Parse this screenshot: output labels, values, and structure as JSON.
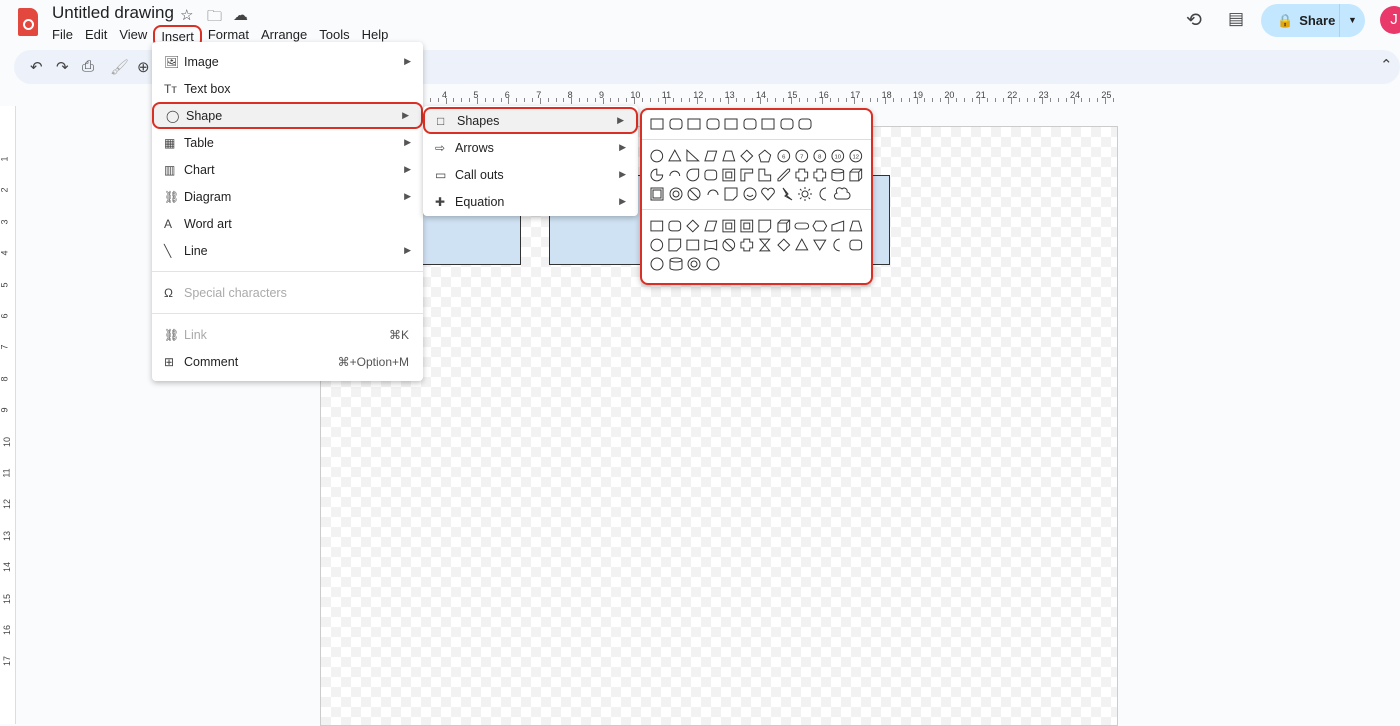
{
  "app": {
    "title": "Untitled drawing",
    "icons": [
      "star-icon",
      "move-to-folder-icon",
      "cloud-saved-icon"
    ]
  },
  "menubar": [
    "File",
    "Edit",
    "View",
    "Insert",
    "Format",
    "Arrange",
    "Tools",
    "Help"
  ],
  "toolbar": {
    "icons": [
      "undo-icon",
      "redo-icon",
      "print-icon",
      "paint-format-icon",
      "zoom-icon"
    ]
  },
  "header": {
    "share_label": "Share",
    "avatar_letter": "J"
  },
  "ruler": {
    "top": [
      4,
      5,
      6,
      7,
      8,
      9,
      10,
      11,
      12,
      13,
      14,
      15,
      16,
      17,
      18,
      19,
      20,
      21,
      22,
      23,
      24,
      25
    ],
    "left": [
      1,
      2,
      3,
      4,
      5,
      6,
      7,
      8,
      9,
      10,
      11,
      12,
      13,
      14,
      15,
      16,
      17
    ]
  },
  "insert_menu": {
    "items": [
      {
        "label": "Image",
        "icon": "image-icon",
        "sub": true
      },
      {
        "label": "Text box",
        "icon": "text-box-icon"
      },
      {
        "label": "Shape",
        "icon": "shape-icon",
        "sub": true,
        "selected": true
      },
      {
        "label": "Table",
        "icon": "table-icon",
        "sub": true
      },
      {
        "label": "Chart",
        "icon": "chart-icon",
        "sub": true
      },
      {
        "label": "Diagram",
        "icon": "diagram-icon",
        "sub": true
      },
      {
        "label": "Word art",
        "icon": "word-art-icon"
      },
      {
        "label": "Line",
        "icon": "line-icon",
        "sub": true
      },
      {
        "sep": true
      },
      {
        "label": "Special characters",
        "icon": "omega-icon",
        "disabled": true
      },
      {
        "sep": true
      },
      {
        "label": "Link",
        "icon": "link-icon",
        "disabled": true,
        "shortcut": "⌘K"
      },
      {
        "label": "Comment",
        "icon": "comment-icon",
        "shortcut": "⌘+Option+M"
      }
    ]
  },
  "shape_menu": {
    "items": [
      {
        "label": "Shapes",
        "icon": "square-icon",
        "selected": true
      },
      {
        "label": "Arrows",
        "icon": "arrow-icon"
      },
      {
        "label": "Call outs",
        "icon": "callout-icon"
      },
      {
        "label": "Equation",
        "icon": "plus-icon"
      }
    ]
  },
  "shapes_palette": {
    "groups": [
      [
        [
          "rect",
          "round",
          "rect",
          "round",
          "rect",
          "round",
          "rect",
          "round",
          "round"
        ]
      ],
      [
        [
          "circle",
          "tri",
          "rtri",
          "para",
          "trap",
          "diamond",
          "pent",
          "n6",
          "n7",
          "n8",
          "n10",
          "n12"
        ],
        [
          "pie",
          "arc",
          "tear",
          "round",
          "frame",
          "corner",
          "lshape",
          "diag",
          "plus",
          "plus",
          "can",
          "cube"
        ],
        [
          "bevel",
          "donut",
          "noSym",
          "arc",
          "fold",
          "smile",
          "heart",
          "bolt",
          "sun",
          "moon",
          "cloud"
        ]
      ],
      [
        [
          "rect",
          "round",
          "diamond",
          "para",
          "frame",
          "frame",
          "fold",
          "cube",
          "term",
          "hex",
          "manual",
          "trap"
        ],
        [
          "circle",
          "fold",
          "rect",
          "wave",
          "noSym",
          "plus",
          "hour",
          "diamond",
          "tri",
          "itri",
          "moon",
          "round"
        ],
        [
          "circle",
          "can",
          "donut",
          "circle"
        ]
      ]
    ]
  },
  "colors": {
    "accent": "#d93025",
    "share_bg": "#c2e7ff",
    "shape_fill": "#cfe2f3",
    "avatar": "#e8396a"
  }
}
